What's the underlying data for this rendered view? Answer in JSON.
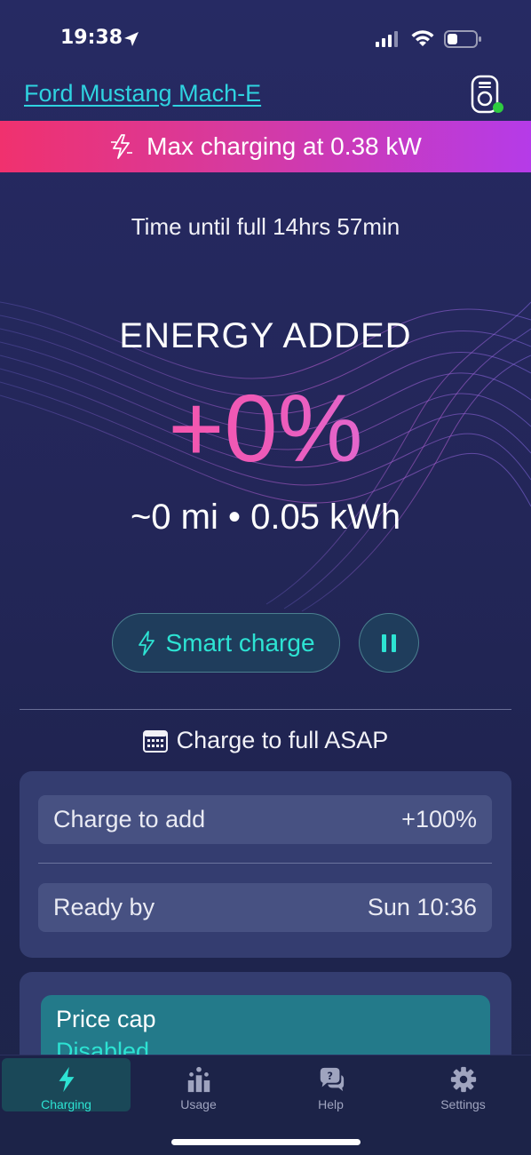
{
  "status_bar": {
    "time": "19:38",
    "icons": [
      "location-arrow-icon",
      "cellular-signal-icon",
      "wifi-icon",
      "battery-icon"
    ]
  },
  "header": {
    "car_name": "Ford Mustang Mach-E",
    "charger_icon": "charger-icon",
    "charger_status_color": "#2ecc40"
  },
  "banner": {
    "text": "Max charging at 0.38 kW",
    "icon": "bolt-icon",
    "gradient": [
      "#f0316e",
      "#b53be8"
    ]
  },
  "session": {
    "time_until_full": "Time until full 14hrs 57min",
    "energy_label": "ENERGY ADDED",
    "energy_percent": "+0%",
    "energy_detail": "~0 mi • 0.05 kWh"
  },
  "controls": {
    "smart_charge_label": "Smart charge",
    "smart_charge_icon": "bolt-icon",
    "pause_icon": "pause-icon"
  },
  "schedule": {
    "mode_label": "Charge to full ASAP",
    "icon": "calendar-icon",
    "rows": [
      {
        "label": "Charge to add",
        "value": "+100%"
      },
      {
        "label": "Ready by",
        "value": "Sun 10:36"
      }
    ]
  },
  "price_cap": {
    "title": "Price cap",
    "status": "Disabled"
  },
  "tabs": [
    {
      "label": "Charging",
      "icon": "bolt-icon",
      "active": true
    },
    {
      "label": "Usage",
      "icon": "usage-chart-icon",
      "active": false
    },
    {
      "label": "Help",
      "icon": "help-chat-icon",
      "active": false
    },
    {
      "label": "Settings",
      "icon": "gear-icon",
      "active": false
    }
  ],
  "colors": {
    "accent_teal": "#2de3d3",
    "link_cyan": "#2fd3e0",
    "energy_pink": "#ff4f9a",
    "energy_violet": "#cf7cf0"
  }
}
